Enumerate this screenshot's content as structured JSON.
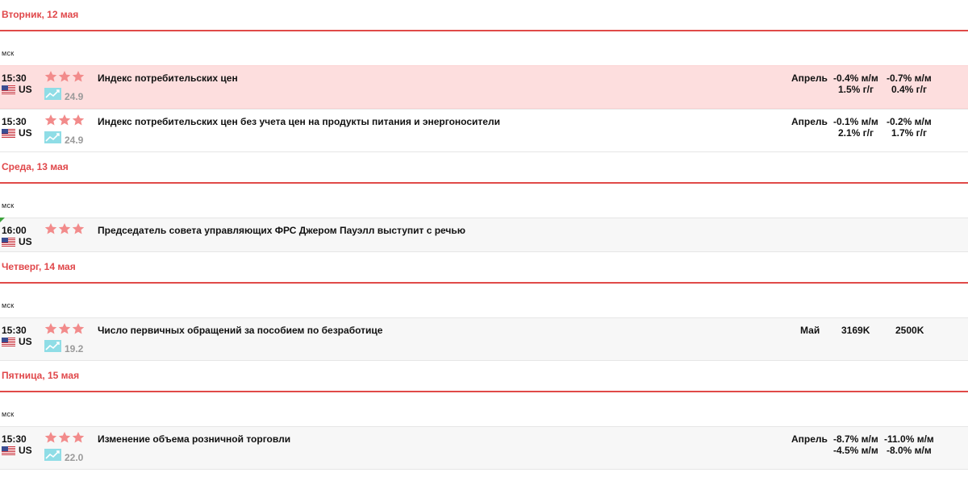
{
  "timezone_label": "мск",
  "days": [
    {
      "title": "Вторник, 12 мая",
      "events": [
        {
          "time": "15:30",
          "country": "US",
          "stars": 3,
          "score": "24.9",
          "title": "Индекс потребительских цен",
          "period": "Апрель",
          "values_line1": [
            "-0.4% м/м",
            "-0.7% м/м"
          ],
          "values_line2": [
            "1.5% г/г",
            "0.4% г/г"
          ],
          "highlight": true
        },
        {
          "time": "15:30",
          "country": "US",
          "stars": 3,
          "score": "24.9",
          "title": "Индекс потребительских цен без учета цен на продукты питания и энергоносители",
          "period": "Апрель",
          "values_line1": [
            "-0.1% м/м",
            "-0.2% м/м"
          ],
          "values_line2": [
            "2.1% г/г",
            "1.7% г/г"
          ],
          "highlight": false
        }
      ]
    },
    {
      "title": "Среда, 13 мая",
      "events": [
        {
          "time": "16:00",
          "country": "US",
          "stars": 3,
          "title": "Председатель совета управляющих ФРС Джером Пауэлл выступит с речью"
        }
      ]
    },
    {
      "title": "Четверг, 14 мая",
      "events": [
        {
          "time": "15:30",
          "country": "US",
          "stars": 3,
          "score": "19.2",
          "title": "Число первичных обращений за пособием по безработице",
          "period": "Май",
          "values_line1": [
            "3169K",
            "2500K"
          ]
        }
      ]
    },
    {
      "title": "Пятница, 15 мая",
      "events": [
        {
          "time": "15:30",
          "country": "US",
          "stars": 3,
          "score": "22.0",
          "title": "Изменение объема розничной торговли",
          "period": "Апрель",
          "values_line1": [
            "-8.7% м/м",
            "-11.0% м/м"
          ],
          "values_line2": [
            "-4.5% м/м",
            "-8.0% м/м"
          ]
        }
      ]
    }
  ],
  "colors": {
    "accent_red": "#e0474a",
    "star": "#f28b8b",
    "highlight_row": "#fddede",
    "sparkline_bg": "#8fdde6",
    "score_gray": "#9a9a9a"
  },
  "icons": {
    "flag": "us-flag-icon",
    "importance": "star-icon",
    "chart": "sparkline-icon"
  }
}
